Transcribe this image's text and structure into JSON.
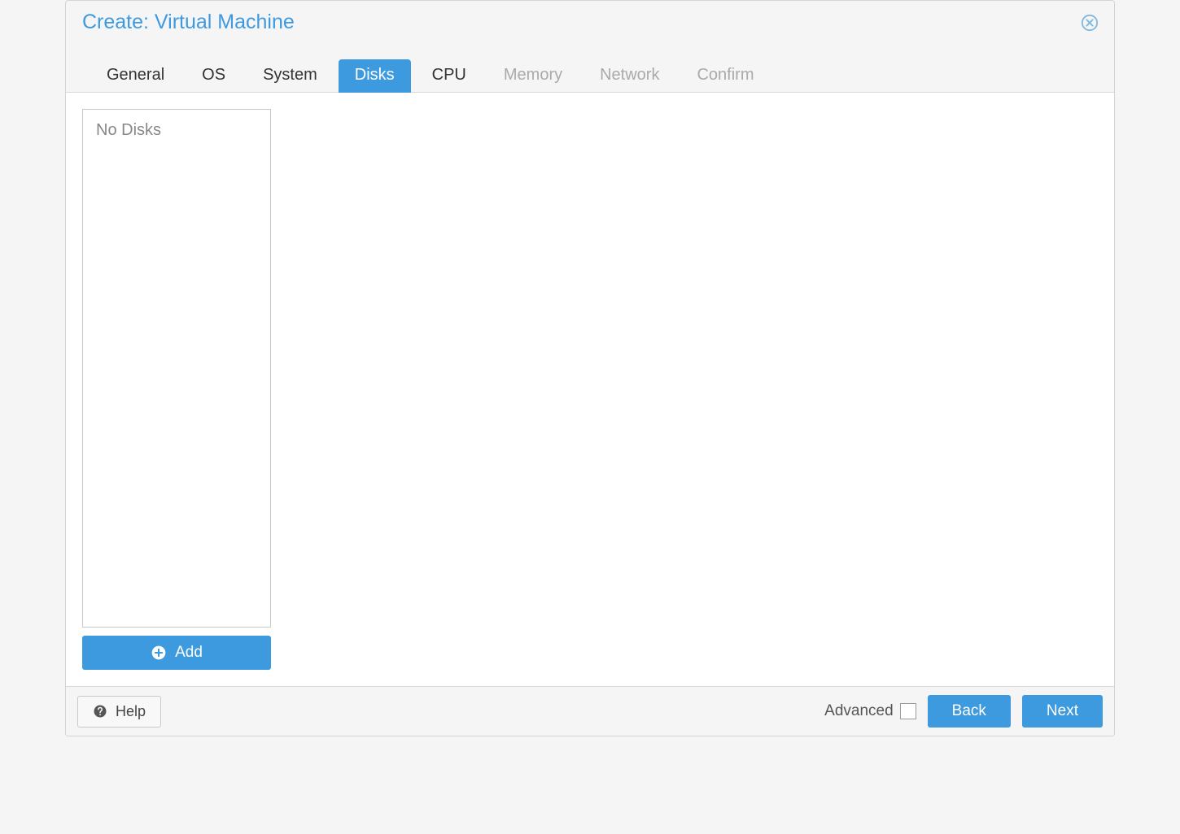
{
  "dialog": {
    "title": "Create: Virtual Machine"
  },
  "tabs": [
    {
      "label": "General",
      "active": false,
      "disabled": false
    },
    {
      "label": "OS",
      "active": false,
      "disabled": false
    },
    {
      "label": "System",
      "active": false,
      "disabled": false
    },
    {
      "label": "Disks",
      "active": true,
      "disabled": false
    },
    {
      "label": "CPU",
      "active": false,
      "disabled": false
    },
    {
      "label": "Memory",
      "active": false,
      "disabled": true
    },
    {
      "label": "Network",
      "active": false,
      "disabled": true
    },
    {
      "label": "Confirm",
      "active": false,
      "disabled": true
    }
  ],
  "disks": {
    "empty_text": "No Disks",
    "add_label": "Add"
  },
  "footer": {
    "help_label": "Help",
    "advanced_label": "Advanced",
    "back_label": "Back",
    "next_label": "Next"
  }
}
